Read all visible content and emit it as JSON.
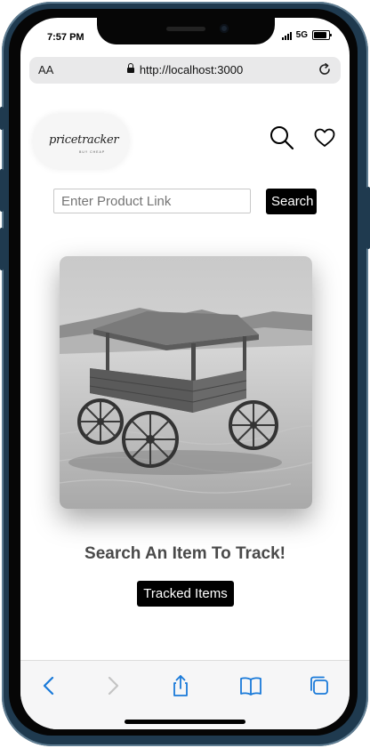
{
  "status_bar": {
    "time": "7:57 PM",
    "network": "5G"
  },
  "browser": {
    "text_size_label": "AA",
    "url": "http://localhost:3000"
  },
  "site": {
    "logo_text": "pricetracker",
    "logo_tagline": "BUY CHEAP"
  },
  "search": {
    "placeholder": "Enter Product Link",
    "button_label": "Search"
  },
  "main": {
    "headline": "Search An Item To Track!",
    "tracked_button_label": "Tracked Items"
  },
  "icons": {
    "header": [
      "search-icon",
      "heart-icon"
    ],
    "toolbar": [
      "back-icon",
      "forward-icon",
      "share-icon",
      "bookmarks-icon",
      "tabs-icon"
    ]
  },
  "colors": {
    "accent": "#1a7ad9",
    "button_bg": "#000000",
    "headline": "#4a4a4a"
  }
}
